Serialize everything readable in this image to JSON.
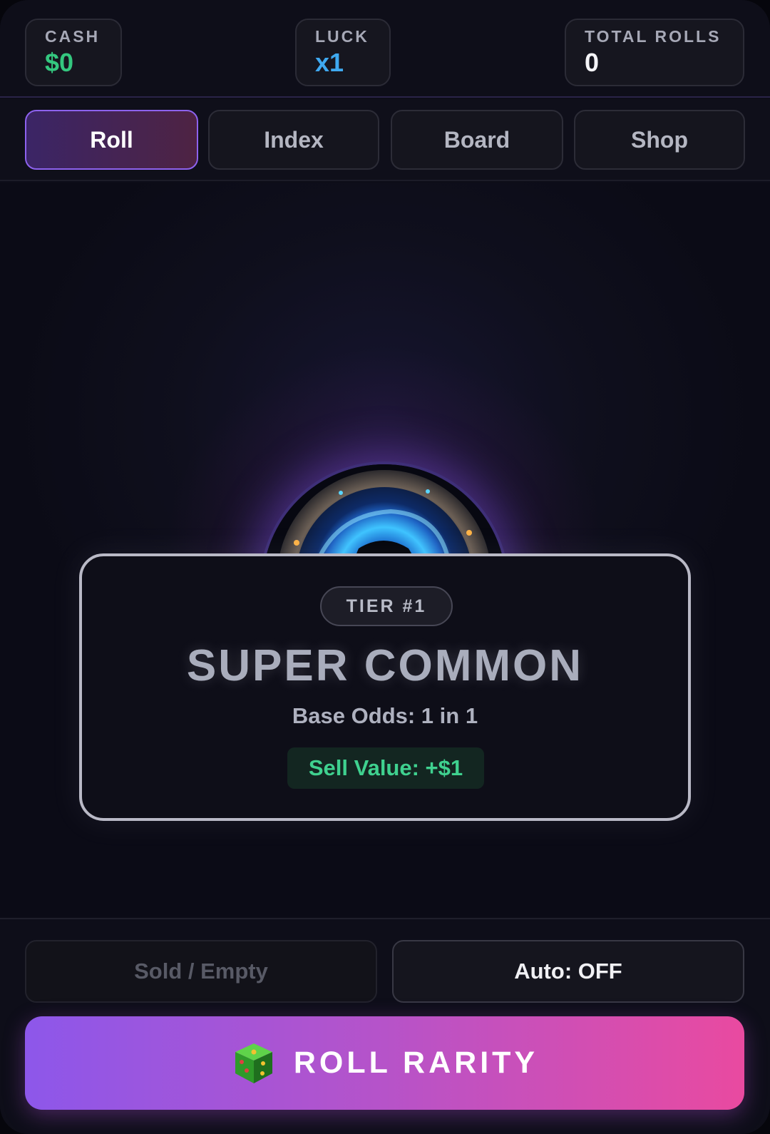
{
  "stats": {
    "cash": {
      "label": "CASH",
      "value": "$0",
      "color": "#34c77f"
    },
    "luck": {
      "label": "LUCK",
      "value": "x1",
      "color": "#3fa9f0"
    },
    "total_rolls": {
      "label": "TOTAL ROLLS",
      "value": "0",
      "color": "#f4f4f8"
    }
  },
  "tabs": [
    {
      "label": "Roll",
      "active": true
    },
    {
      "label": "Index",
      "active": false
    },
    {
      "label": "Board",
      "active": false
    },
    {
      "label": "Shop",
      "active": false
    }
  ],
  "result": {
    "image": "portal-icon",
    "tier": "TIER #1",
    "rarity_name": "SUPER COMMON",
    "odds": "Base Odds: 1 in 1",
    "sell_value": "Sell Value: +$1"
  },
  "controls": {
    "sold_label": "Sold / Empty",
    "auto_label": "Auto: OFF",
    "roll_label": "ROLL RARITY",
    "roll_icon": "dice-icon"
  },
  "colors": {
    "accent_purple": "#8d62ee",
    "accent_pink": "#e94aa0",
    "success_green": "#3fd18f"
  }
}
